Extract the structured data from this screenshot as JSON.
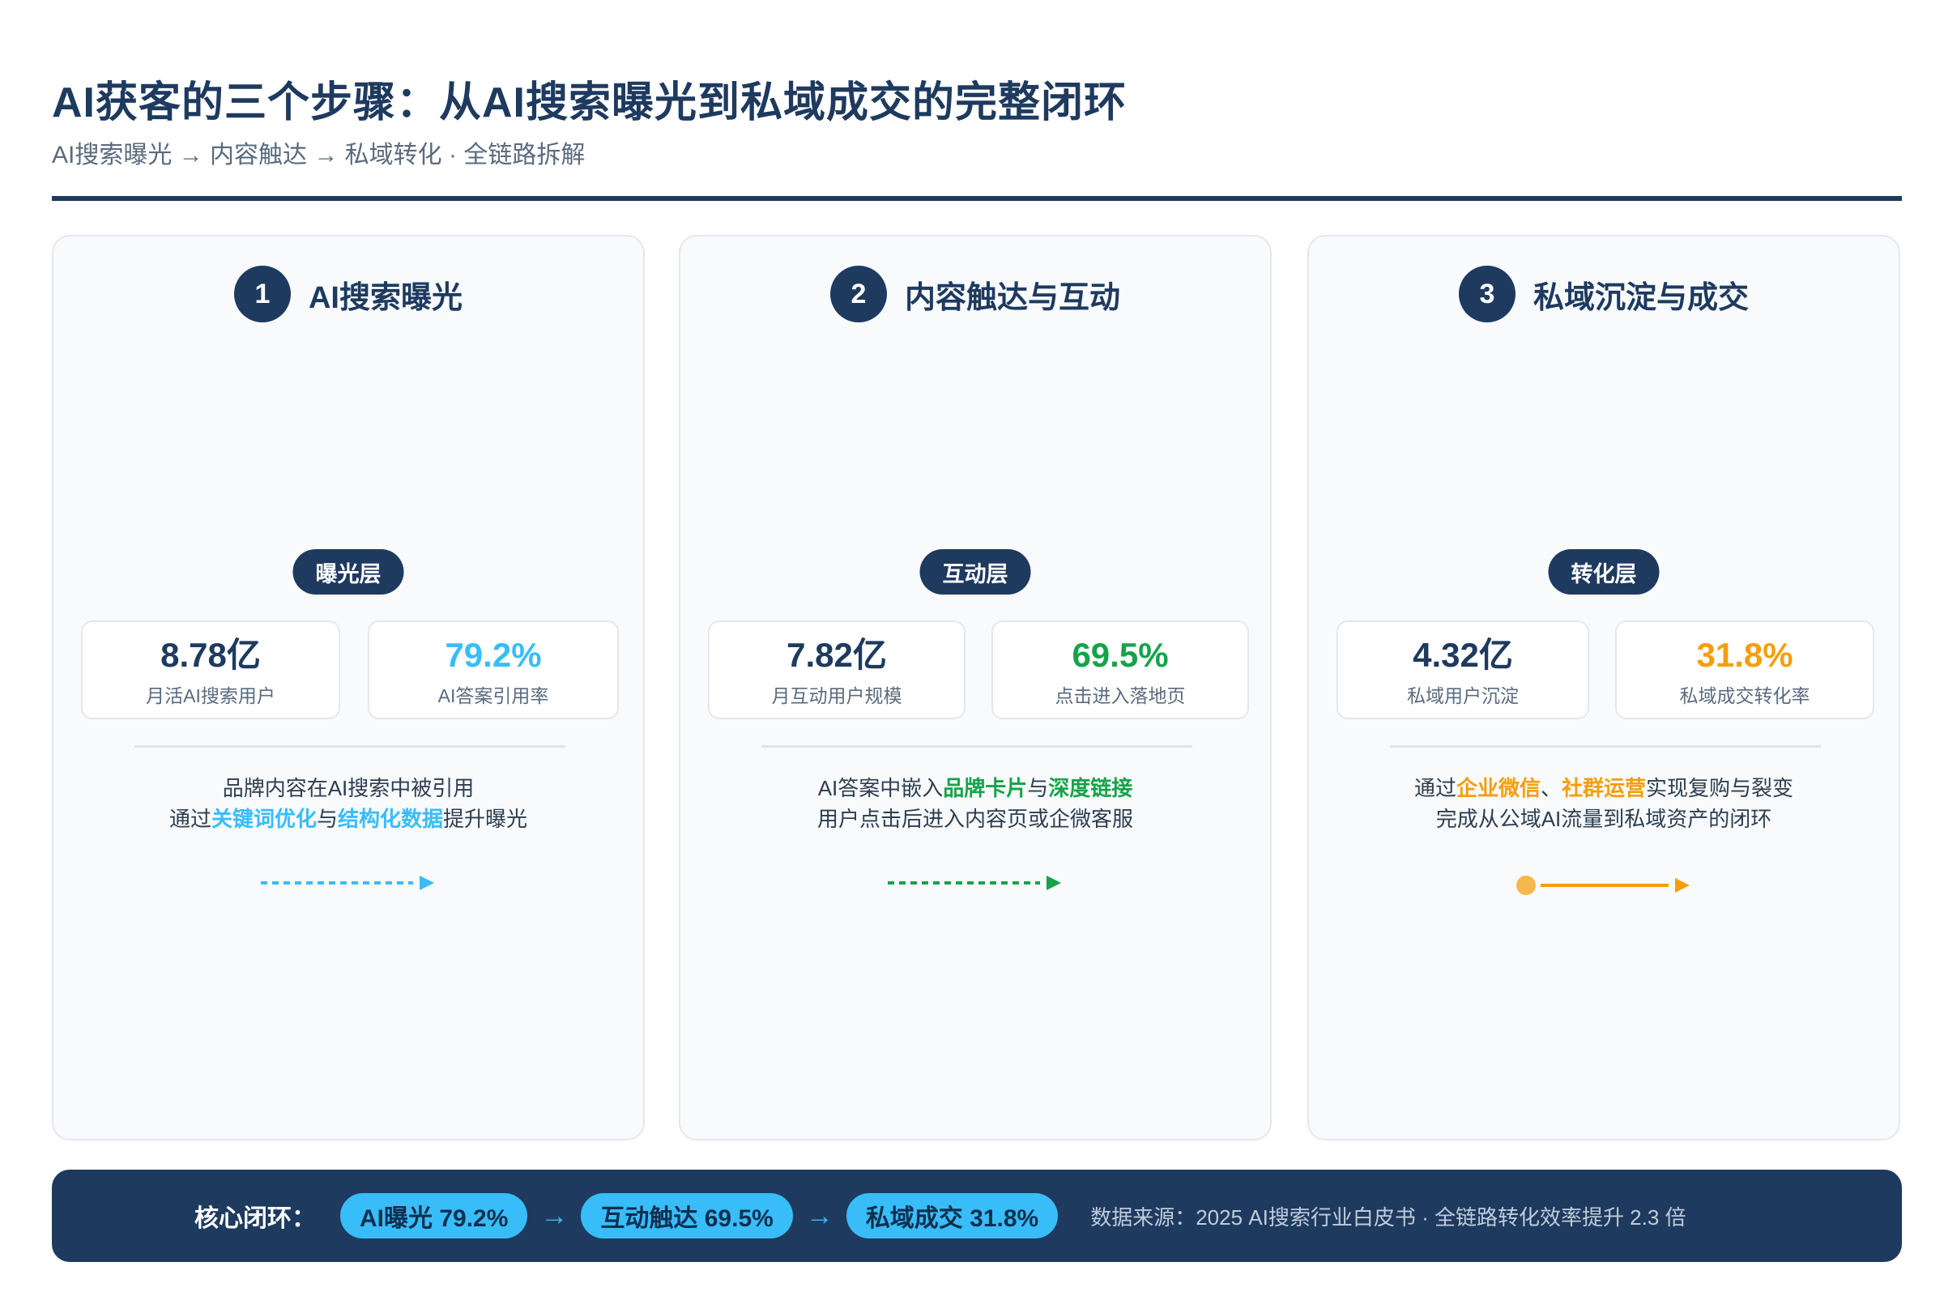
{
  "header": {
    "title": "AI获客的三个步骤：从AI搜索曝光到私域成交的完整闭环",
    "subtitle": "AI搜索曝光 → 内容触达 → 私域转化 · 全链路拆解"
  },
  "colors": {
    "navy": "#1e3a5f",
    "blue": "#38bdf8",
    "green": "#16a34a",
    "orange": "#f59e0b"
  },
  "steps": [
    {
      "number": "1",
      "title": "AI搜索曝光",
      "layer": "曝光层",
      "stat1": {
        "value": "8.78亿",
        "label": "月活AI搜索用户"
      },
      "stat2": {
        "value": "79.2%",
        "label": "AI答案引用率"
      },
      "desc": {
        "line1": "品牌内容在AI搜索中被引用",
        "l2_a": "通过",
        "l2_h1": "关键词优化",
        "l2_b": "与",
        "l2_h2": "结构化数据",
        "l2_c": "提升曝光"
      }
    },
    {
      "number": "2",
      "title": "内容触达与互动",
      "layer": "互动层",
      "stat1": {
        "value": "7.82亿",
        "label": "月互动用户规模"
      },
      "stat2": {
        "value": "69.5%",
        "label": "点击进入落地页"
      },
      "desc": {
        "l1_a": "AI答案中嵌入",
        "l1_h1": "品牌卡片",
        "l1_b": "与",
        "l1_h2": "深度链接",
        "line2": "用户点击后进入内容页或企微客服"
      }
    },
    {
      "number": "3",
      "title": "私域沉淀与成交",
      "layer": "转化层",
      "stat1": {
        "value": "4.32亿",
        "label": "私域用户沉淀"
      },
      "stat2": {
        "value": "31.8%",
        "label": "私域成交转化率"
      },
      "desc": {
        "l1_a": "通过",
        "l1_h1": "企业微信",
        "l1_b": "、",
        "l1_h2": "社群运营",
        "l1_c": "实现复购与裂变",
        "line2": "完成从公域AI流量到私域资产的闭环"
      }
    }
  ],
  "footer": {
    "core_label": "核心闭环：",
    "pills": [
      "AI曝光 79.2%",
      "互动触达 69.5%",
      "私域成交 31.8%"
    ],
    "arrow": "→",
    "source": "数据来源：2025 AI搜索行业白皮书 · 全链路转化效率提升 2.3 倍"
  }
}
